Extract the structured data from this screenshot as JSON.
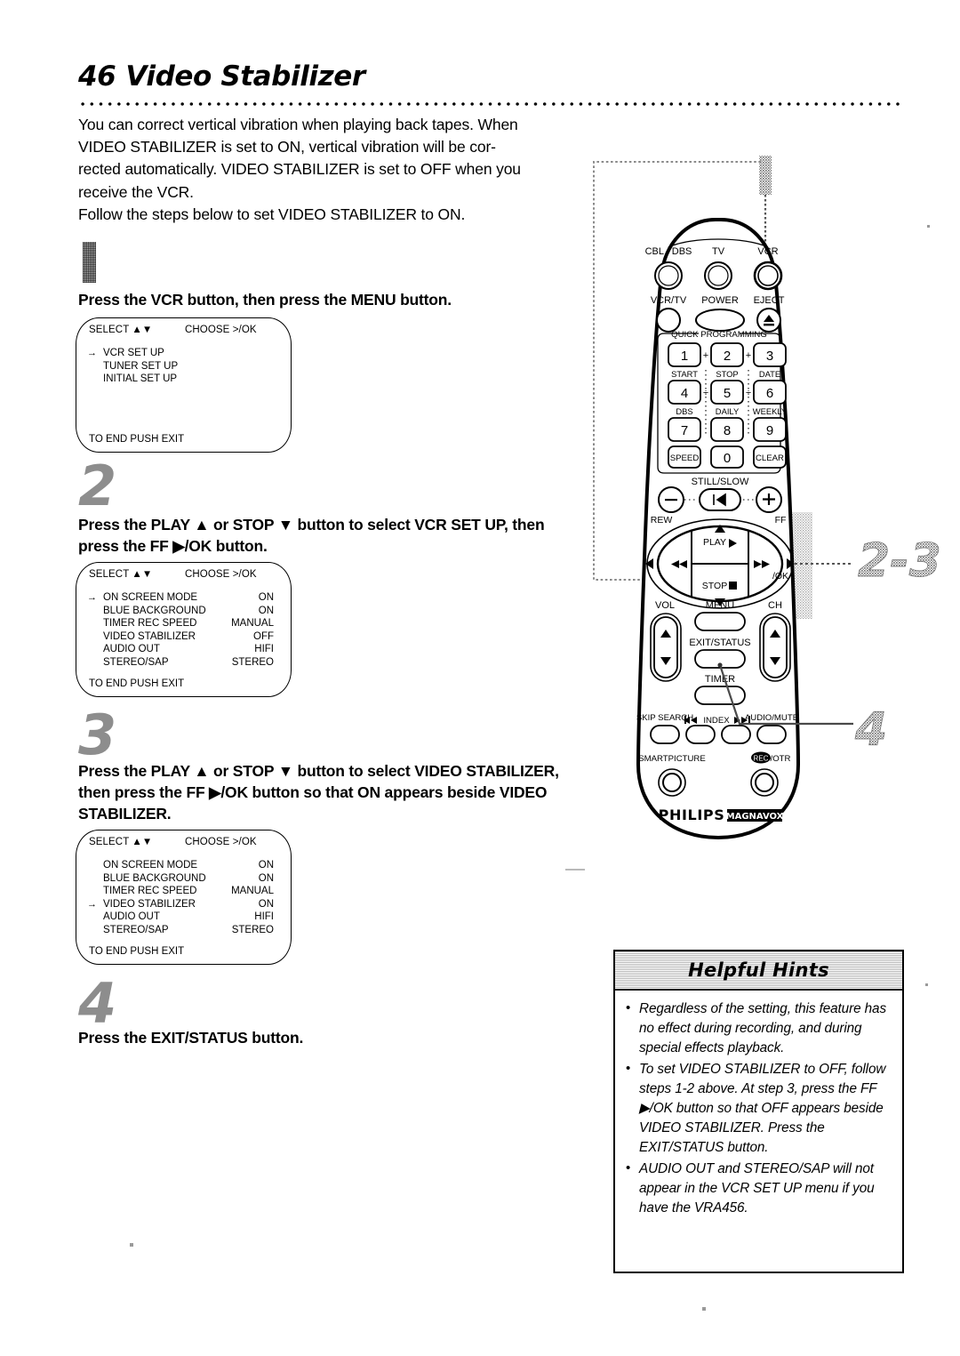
{
  "page": {
    "number": "46",
    "title": "Video Stabilizer"
  },
  "intro": {
    "lines": [
      "You can correct vertical vibration when playing back tapes. When",
      "VIDEO STABILIZER is set to ON, vertical vibration will be cor-",
      "rected automatically. VIDEO STABILIZER is set to OFF when you",
      "receive the VCR.",
      "Follow the steps below to set VIDEO STABILIZER to ON."
    ]
  },
  "steps": [
    {
      "number": "1",
      "instruction": "Press the VCR button, then press the MENU button.",
      "osd": {
        "select_label": "SELECT ▲▼",
        "choose_label": "CHOOSE >/OK",
        "footer": "TO END PUSH EXIT",
        "rows": [
          {
            "arrow": "→",
            "label": "VCR SET UP",
            "value": ""
          },
          {
            "arrow": "",
            "label": "TUNER SET UP",
            "value": ""
          },
          {
            "arrow": "",
            "label": "INITIAL SET UP",
            "value": ""
          }
        ]
      }
    },
    {
      "number": "2",
      "instruction": "Press the PLAY ▲ or STOP ▼ button to select VCR SET UP, then press the FF ▶/OK button.",
      "osd": {
        "select_label": "SELECT ▲▼",
        "choose_label": "CHOOSE >/OK",
        "footer": "TO END PUSH EXIT",
        "rows": [
          {
            "arrow": "→",
            "label": "ON SCREEN MODE",
            "value": "ON"
          },
          {
            "arrow": "",
            "label": "BLUE BACKGROUND",
            "value": "ON"
          },
          {
            "arrow": "",
            "label": "TIMER REC SPEED",
            "value": "MANUAL"
          },
          {
            "arrow": "",
            "label": "VIDEO STABILIZER",
            "value": "OFF"
          },
          {
            "arrow": "",
            "label": "AUDIO OUT",
            "value": "HIFI"
          },
          {
            "arrow": "",
            "label": "STEREO/SAP",
            "value": "STEREO"
          }
        ]
      }
    },
    {
      "number": "3",
      "instruction": "Press the PLAY ▲ or STOP ▼ button to select VIDEO STABILIZER, then press the FF ▶/OK button so that ON appears beside VIDEO STABILIZER.",
      "osd": {
        "select_label": "SELECT ▲▼",
        "choose_label": "CHOOSE >/OK",
        "footer": "TO END PUSH EXIT",
        "rows": [
          {
            "arrow": "",
            "label": "ON SCREEN MODE",
            "value": "ON"
          },
          {
            "arrow": "",
            "label": "BLUE BACKGROUND",
            "value": "ON"
          },
          {
            "arrow": "",
            "label": "TIMER REC SPEED",
            "value": "MANUAL"
          },
          {
            "arrow": "→",
            "label": "VIDEO STABILIZER",
            "value": "ON"
          },
          {
            "arrow": "",
            "label": "AUDIO OUT",
            "value": "HIFI"
          },
          {
            "arrow": "",
            "label": "STEREO/SAP",
            "value": "STEREO"
          }
        ]
      }
    },
    {
      "number": "4",
      "instruction": "Press the EXIT/STATUS button.",
      "osd": null
    }
  ],
  "remote": {
    "callouts": [
      {
        "id": "callout-1",
        "label": "1"
      },
      {
        "id": "callout-2-3",
        "label": "2-3"
      },
      {
        "id": "callout-4",
        "label": "4"
      }
    ],
    "brand": "PHILIPS",
    "brand_sub": "MAGNAVOX",
    "buttons": {
      "cbl_dbs": "CBL / DBS",
      "tv": "TV",
      "vcr": "VCR",
      "vcr_tv": "VCR/TV",
      "power": "POWER",
      "eject": "EJECT",
      "quick_programming": "QUICK PROGRAMMING",
      "keys": [
        "1",
        "2",
        "3",
        "4",
        "5",
        "6",
        "7",
        "8",
        "9"
      ],
      "key_sublabels_row1": [
        "START",
        "STOP",
        "DATE"
      ],
      "key_sublabels_row2": [
        "DBS",
        "DAILY",
        "WEEKLY"
      ],
      "speed": "SPEED",
      "zero": "0",
      "clear": "CLEAR",
      "still_slow": "STILL/SLOW",
      "still_minus": "–",
      "still_plus": "+",
      "rew": "REW",
      "ff": "FF",
      "play": "PLAY",
      "stop": "STOP",
      "ok": "/OK",
      "vol": "VOL",
      "menu": "MENU",
      "ch": "CH",
      "exit_status": "EXIT/STATUS",
      "timer": "TIMER",
      "skip_search": "SKIP SEARCH",
      "index": "INDEX",
      "audio_mute": "AUDIO/MUTE",
      "smartpicture": "SMARTPICTURE",
      "rec": "REC",
      "rec_otr": "/OTR"
    }
  },
  "hints": {
    "title": "Helpful Hints",
    "items": [
      "Regardless of the setting, this feature has no effect during recording, and during special effects playback.",
      "To set VIDEO STABILIZER to OFF, follow steps 1-2 above. At step 3, press the FF ▶/OK button so that OFF appears beside VIDEO STABILIZER. Press the EXIT/STATUS button.",
      "AUDIO OUT and STEREO/SAP will not appear in the VCR SET UP menu if you have the VRA456."
    ]
  }
}
